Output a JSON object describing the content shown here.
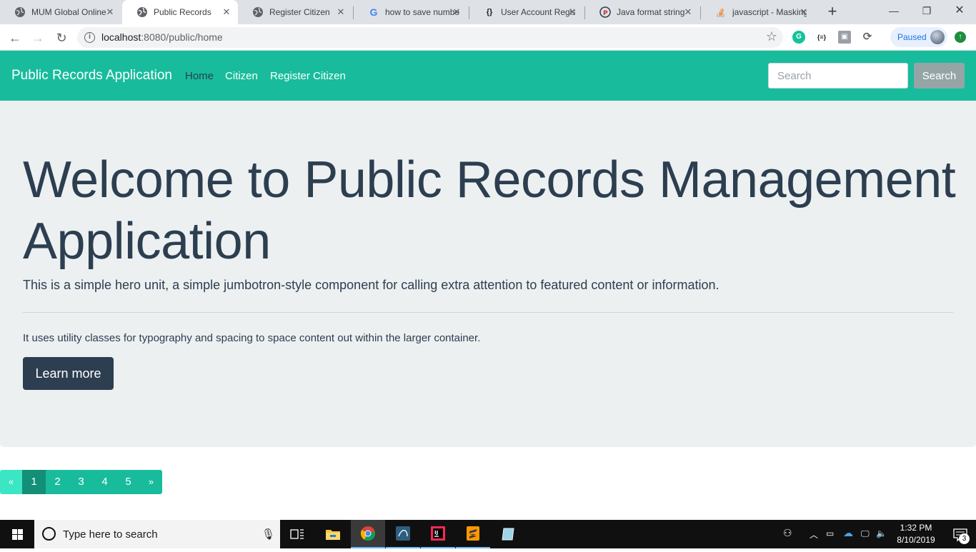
{
  "browser": {
    "tabs": [
      {
        "title": "MUM Global Online",
        "icon": "globe-icon"
      },
      {
        "title": "Public Records",
        "icon": "globe-icon"
      },
      {
        "title": "Register Citizen",
        "icon": "globe-icon"
      },
      {
        "title": "how to save number",
        "icon": "google-icon"
      },
      {
        "title": "User Account Registration",
        "icon": "braces-icon"
      },
      {
        "title": "Java format string",
        "icon": "p-icon"
      },
      {
        "title": "javascript - Masking",
        "icon": "stackoverflow-icon"
      }
    ],
    "active_tab": 1,
    "url_host": "localhost",
    "url_path": ":8080/public/home",
    "paused_label": "Paused"
  },
  "navbar": {
    "brand": "Public Records Application",
    "links": [
      "Home",
      "Citizen",
      "Register Citizen"
    ],
    "active_link": "Home",
    "search_placeholder": "Search",
    "search_button": "Search",
    "bg_color": "#18bc9c"
  },
  "jumbotron": {
    "heading": "Welcome to Public Records Management Application",
    "lead": "This is a simple hero unit, a simple jumbotron-style component for calling extra attention to featured content or information.",
    "body": "It uses utility classes for typography and spacing to space content out within the larger container.",
    "button": "Learn more"
  },
  "pagination": {
    "prev": "«",
    "pages": [
      "1",
      "2",
      "3",
      "4",
      "5"
    ],
    "active_page": "1",
    "next": "»"
  },
  "taskbar": {
    "search_placeholder": "Type here to search",
    "time": "1:32 PM",
    "date": "8/10/2019",
    "notification_count": "3"
  }
}
